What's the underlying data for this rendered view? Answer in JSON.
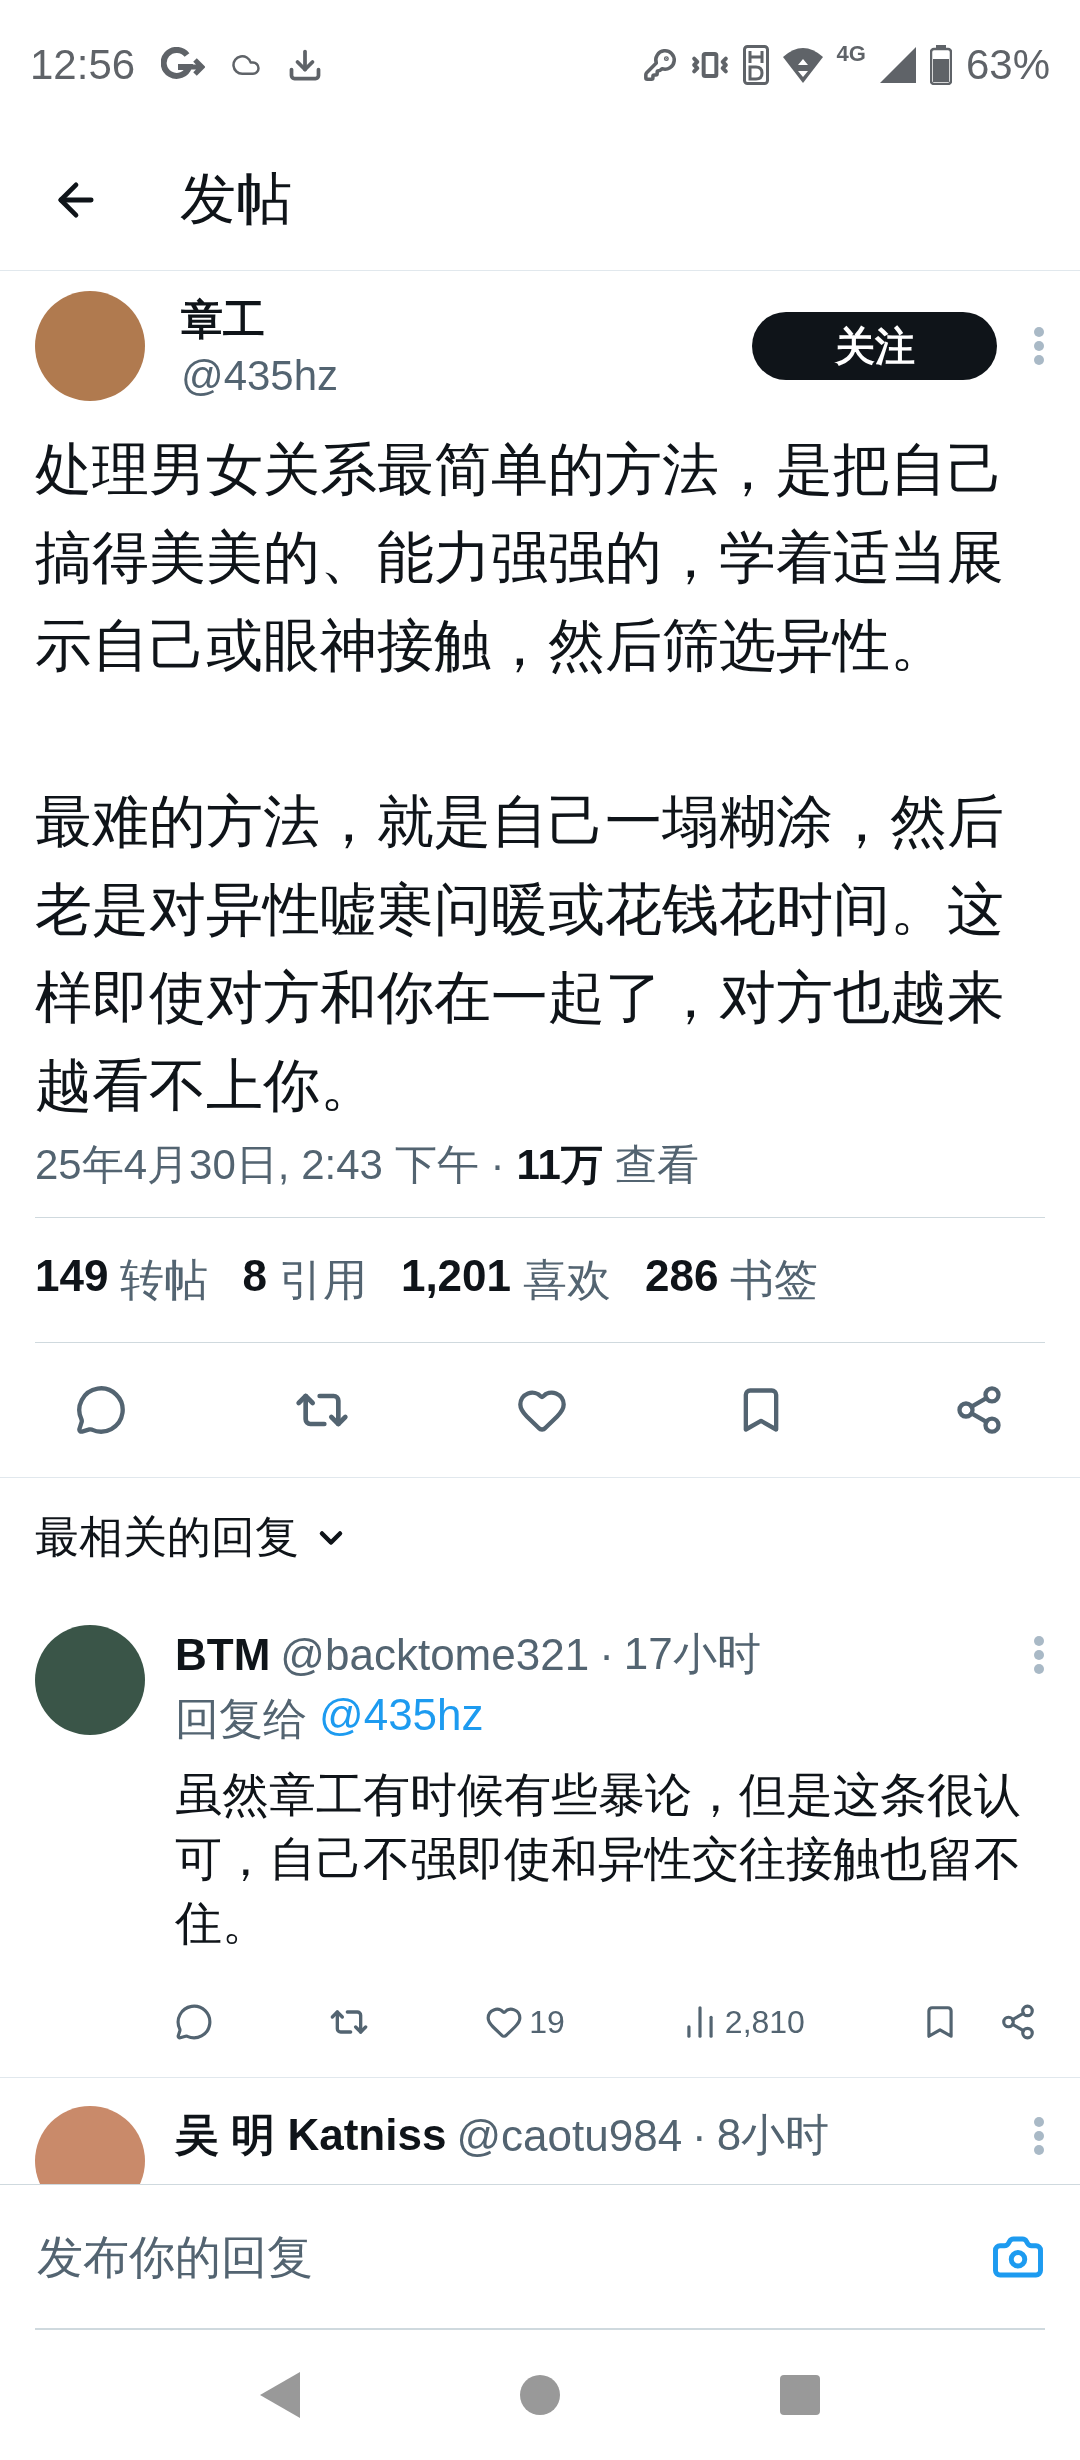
{
  "status_bar": {
    "time": "12:56",
    "network": "4G",
    "battery": "63%"
  },
  "header": {
    "title": "发帖"
  },
  "post": {
    "author": {
      "name": "章工",
      "handle": "@435hz"
    },
    "follow_label": "关注",
    "paragraphs": [
      "处理男女关系最简单的方法，是把自己搞得美美的、能力强强的，学着适当展示自己或眼神接触，然后筛选异性。",
      "最难的方法，就是自己一塌糊涂，然后老是对异性嘘寒问暖或花钱花时间。这样即使对方和你在一起了，对方也越来越看不上你。"
    ],
    "date": "25年4月30日, 2:43 下午",
    "separator": "·",
    "views_count": "11万",
    "views_label": "查看",
    "stats": [
      {
        "count": "149",
        "label": "转帖"
      },
      {
        "count": "8",
        "label": "引用"
      },
      {
        "count": "1,201",
        "label": "喜欢"
      },
      {
        "count": "286",
        "label": "书签"
      }
    ]
  },
  "replies_header": {
    "label": "最相关的回复"
  },
  "replies": [
    {
      "name": "BTM",
      "handle": "@backtome321",
      "separator": "·",
      "time": "17小时",
      "reply_to_label": "回复给",
      "reply_to_handle": "@435hz",
      "text": "虽然章工有时候有些暴论，但是这条很认可，自己不强即使和异性交往接触也留不住。",
      "likes": "19",
      "views": "2,810"
    },
    {
      "name": "吴 明 Katniss",
      "handle": "@caotu984",
      "separator": "·",
      "time": "8小时"
    }
  ],
  "reply_box": {
    "placeholder": "发布你的回复"
  }
}
